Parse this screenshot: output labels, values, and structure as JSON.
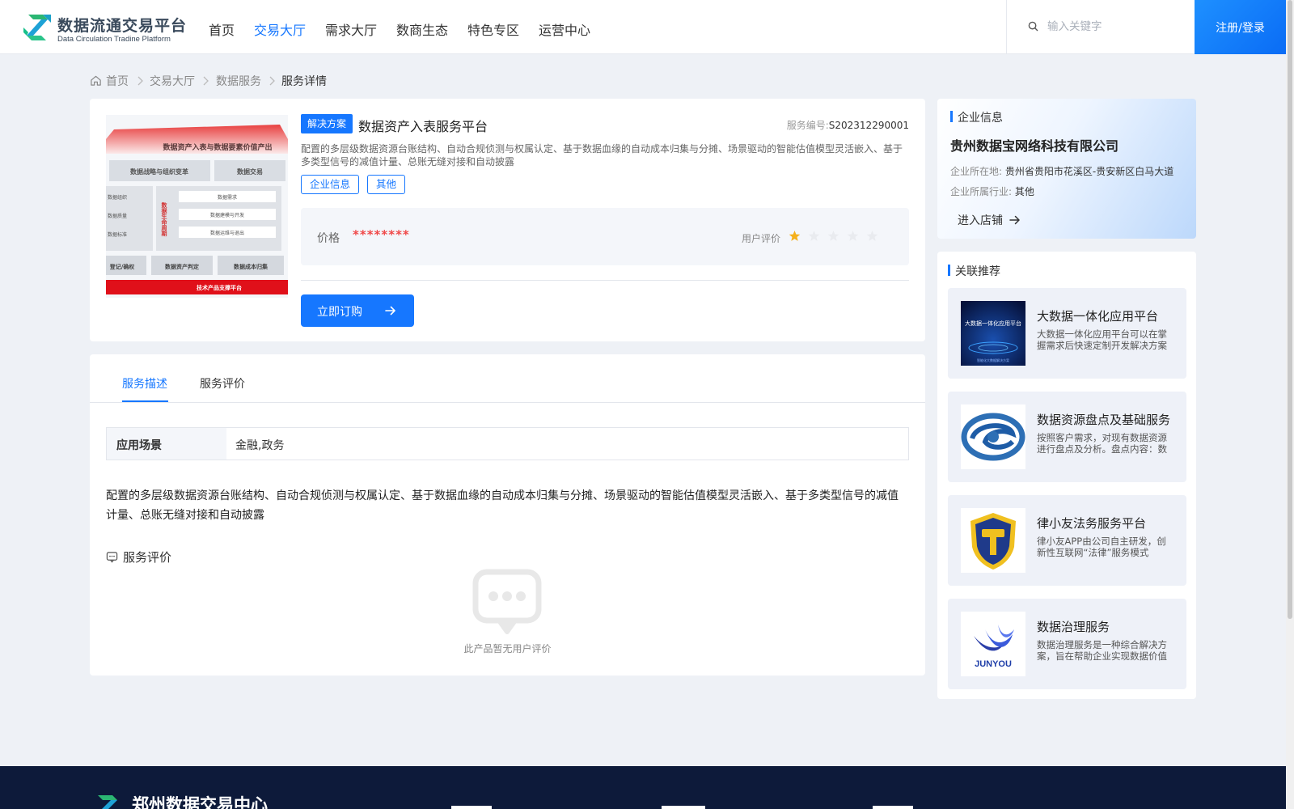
{
  "header": {
    "logo_title": "数据流通交易平台",
    "logo_subtitle": "Data Circulation Tradine Platform",
    "nav": [
      {
        "label": "首页"
      },
      {
        "label": "交易大厅",
        "active": true
      },
      {
        "label": "需求大厅"
      },
      {
        "label": "数商生态"
      },
      {
        "label": "特色专区"
      },
      {
        "label": "运营中心"
      }
    ],
    "search_placeholder": "输入关键字",
    "login_label": "注册/登录"
  },
  "breadcrumb": [
    "首页",
    "交易大厅",
    "数据服务",
    "服务详情"
  ],
  "product": {
    "type_tag": "解决方案",
    "title": "数据资产入表服务平台",
    "service_no_label": "服务编号:",
    "service_no": "S202312290001",
    "description": "配置的多层级数据资源台账结构、自动合规侦测与权属认定、基于数据血缘的自动成本归集与分摊、场景驱动的智能估值模型灵活嵌入、基于多类型信号的减值计量、总账无缝对接和自动披露",
    "tags": [
      "企业信息",
      "其他"
    ],
    "price_label": "价格",
    "price_value": "********",
    "rating_label": "用户评价",
    "rating": 1,
    "rating_max": 5,
    "buy_label": "立即订购",
    "image_texts": {
      "banner": "数据资产入表与数据要素价值产出",
      "box1": "数据战略与组织变革",
      "box2": "数据交易",
      "side1": "数据组织",
      "side2": "数据质量",
      "side3": "数据标准",
      "vertical": "数据生命周期",
      "mid1": "数据需求",
      "mid2": "数据建模与开发",
      "mid3": "数据运维与退出",
      "bottom1": "登记/确权",
      "bottom2": "数据资产判定",
      "bottom3": "数据成本归集",
      "footer": "技术产品支撑平台"
    }
  },
  "detail": {
    "tabs": [
      {
        "label": "服务描述",
        "active": true
      },
      {
        "label": "服务评价"
      }
    ],
    "scene_label": "应用场景",
    "scene_value": "金融,政务",
    "long_description": "配置的多层级数据资源台账结构、自动合规侦测与权属认定、基于数据血缘的自动成本归集与分摊、场景驱动的智能估值模型灵活嵌入、基于多类型信号的减值计量、总账无缝对接和自动披露",
    "review_section_title": "服务评价",
    "empty_review_text": "此产品暂无用户评价"
  },
  "company": {
    "section_title": "企业信息",
    "name": "贵州数据宝网络科技有限公司",
    "location_label": "企业所在地:",
    "location": "贵州省贵阳市花溪区-贵安新区白马大道",
    "industry_label": "企业所属行业:",
    "industry": "其他",
    "shop_link": "进入店铺"
  },
  "recommend": {
    "section_title": "关联推荐",
    "items": [
      {
        "title": "大数据一体化应用平台",
        "desc": "大数据一体化应用平台可以在掌握需求后快速定制开发解决方案",
        "thumb_text": "大数据一体化应用平台",
        "thumb_caption": "智能化大数据解决方案"
      },
      {
        "title": "数据资源盘点及基础服务",
        "desc": "按照客户需求，对现有数据资源进行盘点及分析。盘点内容：数据资源"
      },
      {
        "title": "律小友法务服务平台",
        "desc": "律小友APP由公司自主研发，创新性互联网“法律”服务模式"
      },
      {
        "title": "数据治理服务",
        "desc": "数据治理服务是一种综合解决方案，旨在帮助企业实现数据价值",
        "thumb_text": "JUNYOU"
      }
    ]
  },
  "footer": {
    "title": "郑州数据交易中心"
  },
  "colors": {
    "accent": "#1677ff",
    "price": "#f04848",
    "star": "#f5b01b",
    "footer_bg": "#0d1a3a"
  },
  "icons": [
    "logo-mark-icon",
    "search-icon",
    "home-icon",
    "chevron-right-icon",
    "star-icon",
    "arrow-right-icon",
    "comment-icon",
    "empty-chat-icon"
  ]
}
